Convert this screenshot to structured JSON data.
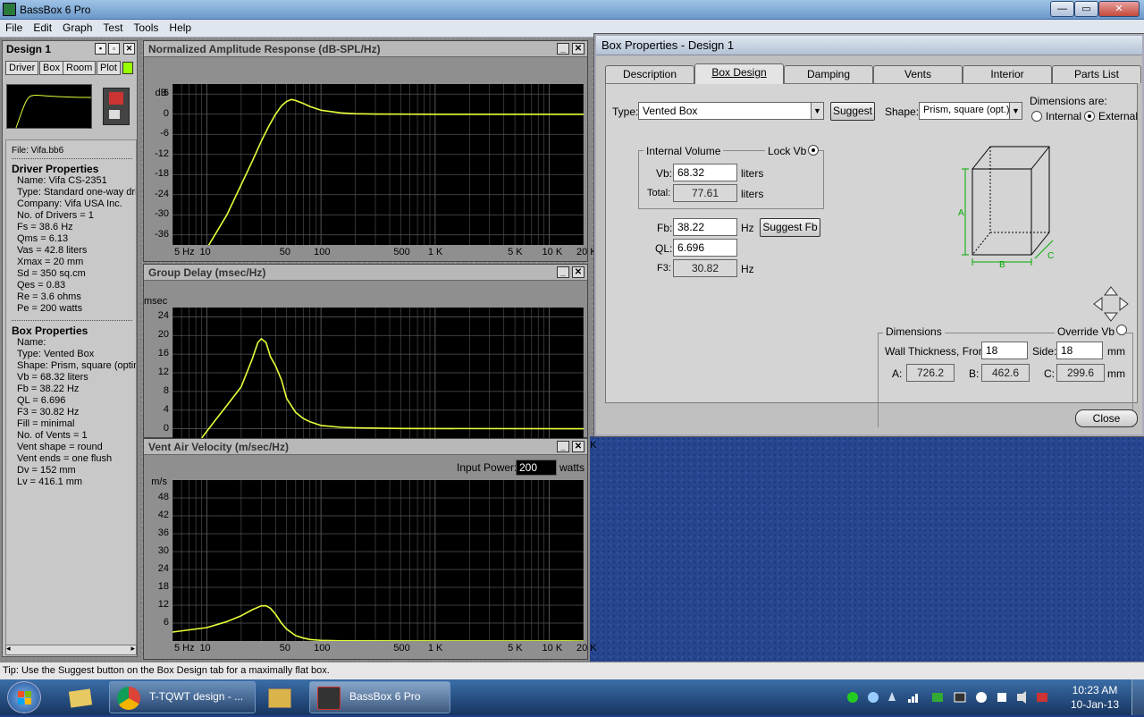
{
  "window": {
    "title": "BassBox 6 Pro"
  },
  "menu": [
    "File",
    "Edit",
    "Graph",
    "Test",
    "Tools",
    "Help"
  ],
  "design": {
    "title": "Design 1",
    "tabs": [
      "Driver",
      "Box",
      "Room",
      "Plot"
    ],
    "file": "File: Vifa.bb6",
    "driver_heading": "Driver Properties",
    "driver_lines": [
      "Name: Vifa CS-2351",
      "Type: Standard one-way driver",
      "Company: Vifa USA Inc.",
      "No. of Drivers = 1",
      "Fs =  38.6 Hz",
      "Qms =  6.13",
      "Vas =  42.8 liters",
      "Xmax =  20 mm",
      "Sd =  350 sq.cm",
      "Qes =  0.83",
      "Re =  3.6 ohms",
      "Pe =  200 watts"
    ],
    "box_heading": "Box Properties",
    "box_lines": [
      "Name:",
      "Type: Vented Box",
      "Shape: Prism, square (optimum)",
      "Vb = 68.32 liters",
      "Fb = 38.22 Hz",
      "QL =  6.696",
      "F3 = 30.82 Hz",
      "Fill = minimal",
      "No. of Vents = 1",
      "Vent shape = round",
      "Vent ends = one flush",
      "Dv =  152 mm",
      "Lv =  416.1 mm"
    ]
  },
  "graphs": {
    "amplitude": {
      "title": "Normalized Amplitude Response (dB-SPL/Hz)",
      "unit": "dB",
      "yticks": [
        "6",
        "0",
        "-6",
        "-12",
        "-18",
        "-24",
        "-30",
        "-36"
      ]
    },
    "delay": {
      "title": "Group Delay (msec/Hz)",
      "unit": "msec",
      "yticks": [
        "24",
        "20",
        "16",
        "12",
        "8",
        "4",
        "0"
      ]
    },
    "velocity": {
      "title": "Vent Air Velocity (m/sec/Hz)",
      "unit": "m/s",
      "yticks": [
        "48",
        "42",
        "36",
        "30",
        "24",
        "18",
        "12",
        "6"
      ],
      "input_power_label": "Input Power:",
      "input_power": "200",
      "input_power_unit": "watts"
    },
    "xticks": [
      "5 Hz",
      "10",
      "50",
      "100",
      "500",
      "1 K",
      "5 K",
      "10 K",
      "20 K"
    ]
  },
  "chart_data": [
    {
      "type": "line",
      "title": "Normalized Amplitude Response (dB-SPL/Hz)",
      "ylabel": "dB",
      "xscale": "log",
      "xlim": [
        5,
        20000
      ],
      "ylim": [
        -39,
        9
      ],
      "series": [
        {
          "x": [
            10,
            15,
            20,
            25,
            30,
            35,
            40,
            45,
            50,
            55,
            60,
            70,
            80,
            100,
            150,
            200,
            300,
            1000,
            20000
          ],
          "y": [
            -40,
            -30,
            -21,
            -14,
            -8,
            -3.5,
            0,
            2.5,
            3.8,
            4.4,
            4.1,
            3.2,
            2.3,
            1.2,
            0.4,
            0.15,
            0.05,
            0,
            0
          ]
        }
      ]
    },
    {
      "type": "line",
      "title": "Group Delay (msec/Hz)",
      "ylabel": "msec",
      "xscale": "log",
      "xlim": [
        5,
        20000
      ],
      "ylim": [
        -2,
        26
      ],
      "series": [
        {
          "x": [
            9,
            12,
            15,
            20,
            25,
            28,
            30,
            33,
            36,
            40,
            45,
            50,
            60,
            70,
            80,
            100,
            150,
            200,
            500,
            20000
          ],
          "y": [
            -2,
            2,
            5,
            9,
            15,
            18.5,
            19.3,
            18.5,
            15.5,
            13.5,
            10.5,
            6.5,
            3.5,
            2.2,
            1.5,
            0.7,
            0.3,
            0.2,
            0.05,
            0
          ]
        }
      ]
    },
    {
      "type": "line",
      "title": "Vent Air Velocity (m/sec/Hz)",
      "ylabel": "m/s",
      "xscale": "log",
      "xlim": [
        5,
        20000
      ],
      "ylim": [
        0,
        54
      ],
      "series": [
        {
          "x": [
            5,
            10,
            15,
            20,
            25,
            30,
            33,
            36,
            40,
            45,
            50,
            60,
            70,
            80,
            100,
            150,
            20000
          ],
          "y": [
            3,
            4.5,
            6.5,
            8.5,
            10.5,
            11.8,
            11.8,
            11,
            9,
            6,
            4,
            1.8,
            1,
            0.5,
            0.2,
            0.05,
            0
          ]
        }
      ]
    }
  ],
  "props": {
    "title": "Box Properties - Design 1",
    "tabs": [
      "Description",
      "Box Design",
      "Damping",
      "Vents",
      "Interior",
      "Parts List"
    ],
    "type_label": "Type:",
    "type_value": "Vented Box",
    "suggest": "Suggest",
    "shape_label": "Shape:",
    "shape_value": "Prism, square (opt.)",
    "dims_are": "Dimensions are:",
    "internal": "Internal",
    "external": "External",
    "internal_volume": "Internal Volume",
    "lock_vb": "Lock Vb",
    "vb_label": "Vb:",
    "vb": "68.32",
    "liters": "liters",
    "total_label": "Total:",
    "total": "77.61",
    "fb_label": "Fb:",
    "fb": "38.22",
    "hz": "Hz",
    "suggest_fb": "Suggest Fb",
    "ql_label": "QL:",
    "ql": "6.696",
    "f3_label": "F3:",
    "f3": "30.82",
    "diagram": {
      "a": "A",
      "b": "B",
      "c": "C"
    },
    "dimensions": "Dimensions",
    "override_vb": "Override Vb",
    "wall_label": "Wall Thickness, Front:",
    "wall_front": "18",
    "side_label": "Side:",
    "wall_side": "18",
    "mm": "mm",
    "a_label": "A:",
    "a": "726.2",
    "b_label": "B:",
    "b": "462.6",
    "c_label": "C:",
    "c": "299.6",
    "close": "Close"
  },
  "status": "Tip: Use the Suggest button on the Box Design tab for a maximally flat box.",
  "taskbar": {
    "items": [
      "T-TQWT design - ...",
      "BassBox 6 Pro"
    ],
    "time": "10:23 AM",
    "date": "10-Jan-13"
  },
  "colors": {
    "curve": "#e8ff3a",
    "plot_bg": "#000000",
    "grid": "#555555"
  }
}
